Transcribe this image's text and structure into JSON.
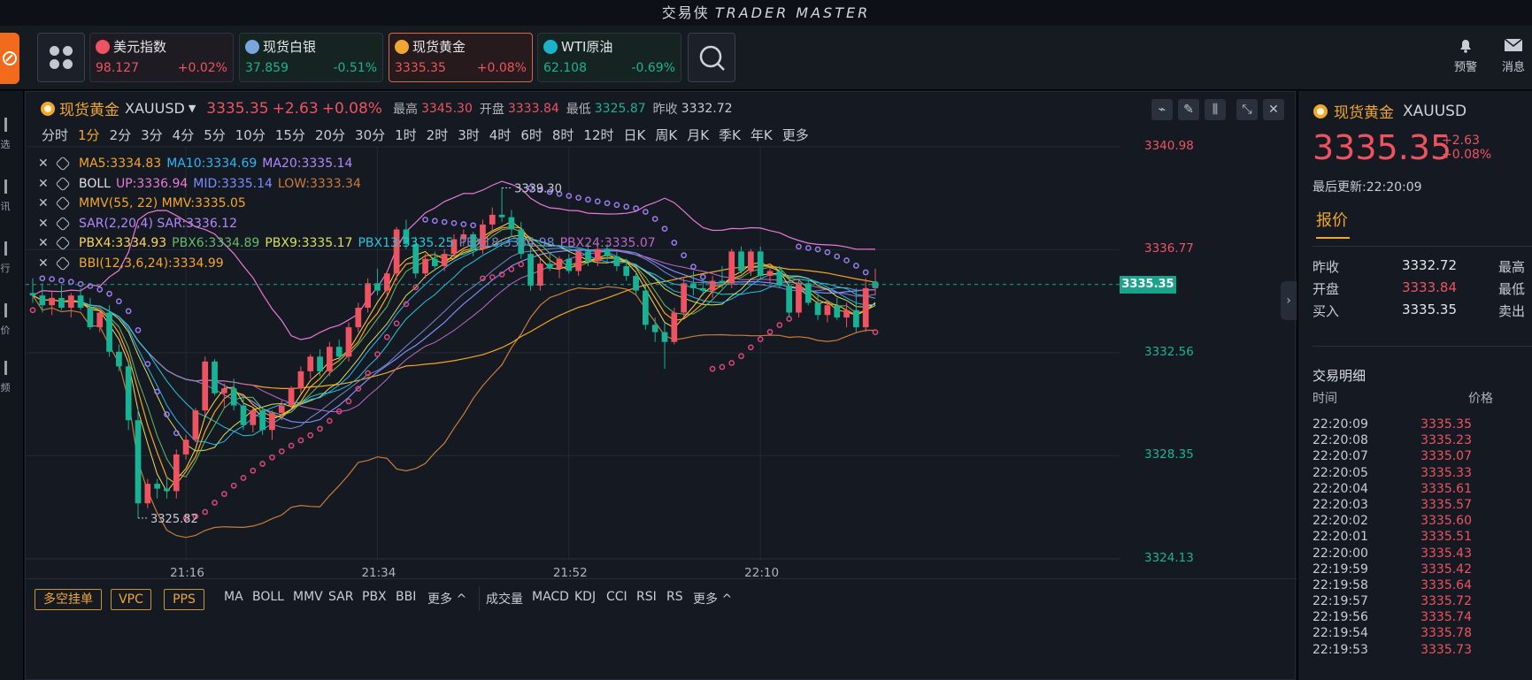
{
  "app": {
    "title_cn": "交易侠",
    "title_en": "TRADER MASTER"
  },
  "quotes": [
    {
      "name": "美元指数",
      "price": "98.127",
      "change": "+0.02%",
      "dir": "up",
      "icon": "us-flag-icon",
      "color": "#ef5260"
    },
    {
      "name": "现货白银",
      "price": "37.859",
      "change": "-0.51%",
      "dir": "dn",
      "icon": "silver-icon",
      "color": "#7aa6e0"
    },
    {
      "name": "现货黄金",
      "price": "3335.35",
      "change": "+0.08%",
      "dir": "up",
      "icon": "gold-icon",
      "color": "#f0a732",
      "active": true
    },
    {
      "name": "WTI原油",
      "price": "62.108",
      "change": "-0.69%",
      "dir": "dn",
      "icon": "oil-icon",
      "color": "#1ab3c9"
    }
  ],
  "top_right": {
    "alert_label": "预警",
    "message_label": "消息"
  },
  "left_strip": [
    "选",
    "讯",
    "行",
    "价",
    "频"
  ],
  "chart_header": {
    "name": "现货黄金",
    "code": "XAUUSD",
    "price": "3335.35",
    "change": "+2.63",
    "change_pct": "+0.08%",
    "high_label": "最高",
    "high": "3345.30",
    "open_label": "开盘",
    "open": "3333.84",
    "low_label": "最低",
    "low": "3325.87",
    "prev_label": "昨收",
    "prev": "3332.72"
  },
  "periods": [
    "分时",
    "1分",
    "2分",
    "3分",
    "4分",
    "5分",
    "10分",
    "15分",
    "20分",
    "30分",
    "1时",
    "2时",
    "3时",
    "4时",
    "6时",
    "8时",
    "12时",
    "日K",
    "周K",
    "月K",
    "季K",
    "年K",
    "更多"
  ],
  "active_period": "1分",
  "indicators": [
    [
      {
        "t": "MA5:3334.83",
        "c": "#f5a623"
      },
      {
        "t": "MA10:3334.69",
        "c": "#29b6f6"
      },
      {
        "t": "MA20:3335.14",
        "c": "#b388ff"
      }
    ],
    [
      {
        "t": "BOLL",
        "c": "#e0e0e0"
      },
      {
        "t": "UP:3336.94",
        "c": "#e879d8"
      },
      {
        "t": "MID:3335.14",
        "c": "#7b8cff"
      },
      {
        "t": "LOW:3333.34",
        "c": "#c97b3a"
      }
    ],
    [
      {
        "t": "MMV(55, 22) MMV:3335.05",
        "c": "#f5a623"
      }
    ],
    [
      {
        "t": "SAR(2,20,4) SAR:3336.12",
        "c": "#b388ff"
      }
    ],
    [
      {
        "t": "PBX4:3334.93",
        "c": "#ffd54f"
      },
      {
        "t": "PBX6:3334.89",
        "c": "#66bb6a"
      },
      {
        "t": "PBX9:3335.17",
        "c": "#d4e157"
      },
      {
        "t": "PBX13:3335.25",
        "c": "#26c6da"
      },
      {
        "t": "PBX18:3334.98",
        "c": "#7986cb"
      },
      {
        "t": "PBX24:3335.07",
        "c": "#ba68c8"
      }
    ],
    [
      {
        "t": "BBI(12,3,6,24):3334.99",
        "c": "#f5a623"
      }
    ]
  ],
  "chart_data": {
    "type": "candlestick",
    "symbol": "XAUUSD",
    "y_ticks": [
      "3340.98",
      "3336.77",
      "3332.56",
      "3328.35",
      "3324.13"
    ],
    "x_ticks": [
      "21:16",
      "21:34",
      "21:52",
      "22:10"
    ],
    "ylim": [
      3324.13,
      3340.98
    ],
    "current": "3335.35",
    "max_label": "3339.30",
    "min_label": "3325.82",
    "candles": [
      [
        3335.0,
        3335.6,
        3334.6,
        3334.9
      ],
      [
        3334.9,
        3335.4,
        3334.2,
        3334.5
      ],
      [
        3334.5,
        3335.1,
        3334.1,
        3334.8
      ],
      [
        3334.8,
        3335.3,
        3334.3,
        3334.4
      ],
      [
        3334.4,
        3335.0,
        3334.0,
        3334.9
      ],
      [
        3334.9,
        3335.2,
        3334.3,
        3334.4
      ],
      [
        3334.4,
        3334.8,
        3333.5,
        3333.6
      ],
      [
        3333.6,
        3334.3,
        3333.4,
        3334.2
      ],
      [
        3334.2,
        3334.5,
        3332.4,
        3332.6
      ],
      [
        3332.6,
        3332.9,
        3331.8,
        3332.0
      ],
      [
        3332.0,
        3332.2,
        3329.4,
        3329.8
      ],
      [
        3329.8,
        3330.3,
        3325.8,
        3326.4
      ],
      [
        3326.4,
        3327.4,
        3326.2,
        3327.2
      ],
      [
        3327.2,
        3327.4,
        3326.6,
        3327.0
      ],
      [
        3327.0,
        3327.5,
        3326.6,
        3326.9
      ],
      [
        3326.9,
        3328.6,
        3326.6,
        3328.4
      ],
      [
        3328.4,
        3329.2,
        3328.2,
        3329.0
      ],
      [
        3329.0,
        3330.3,
        3328.9,
        3330.2
      ],
      [
        3330.2,
        3332.4,
        3330.0,
        3332.2
      ],
      [
        3332.2,
        3332.3,
        3330.8,
        3330.9
      ],
      [
        3330.9,
        3331.3,
        3330.3,
        3331.1
      ],
      [
        3331.1,
        3331.5,
        3330.2,
        3330.4
      ],
      [
        3330.4,
        3330.8,
        3329.4,
        3329.6
      ],
      [
        3329.6,
        3330.3,
        3329.3,
        3330.2
      ],
      [
        3330.2,
        3330.3,
        3329.2,
        3329.4
      ],
      [
        3329.4,
        3330.2,
        3329.0,
        3330.1
      ],
      [
        3330.1,
        3330.6,
        3329.8,
        3330.4
      ],
      [
        3330.4,
        3331.2,
        3330.3,
        3331.1
      ],
      [
        3331.1,
        3332.0,
        3330.9,
        3331.8
      ],
      [
        3331.8,
        3332.5,
        3331.5,
        3332.4
      ],
      [
        3332.4,
        3332.7,
        3331.6,
        3331.8
      ],
      [
        3331.8,
        3333.0,
        3331.6,
        3332.8
      ],
      [
        3332.8,
        3333.1,
        3332.2,
        3332.4
      ],
      [
        3332.4,
        3333.8,
        3332.2,
        3333.6
      ],
      [
        3333.6,
        3334.6,
        3333.4,
        3334.4
      ],
      [
        3334.4,
        3335.6,
        3334.2,
        3335.4
      ],
      [
        3335.4,
        3336.0,
        3334.9,
        3335.1
      ],
      [
        3335.1,
        3335.9,
        3334.9,
        3335.8
      ],
      [
        3335.8,
        3337.7,
        3335.5,
        3337.6
      ],
      [
        3337.6,
        3338.0,
        3336.8,
        3337.0
      ],
      [
        3337.0,
        3337.3,
        3335.6,
        3335.8
      ],
      [
        3335.8,
        3336.6,
        3335.6,
        3336.4
      ],
      [
        3336.4,
        3336.7,
        3336.0,
        3336.1
      ],
      [
        3336.1,
        3336.8,
        3335.9,
        3336.6
      ],
      [
        3336.6,
        3337.4,
        3336.4,
        3337.2
      ],
      [
        3337.2,
        3337.6,
        3336.9,
        3337.4
      ],
      [
        3337.4,
        3337.5,
        3336.5,
        3336.8
      ],
      [
        3336.8,
        3338.0,
        3336.6,
        3337.8
      ],
      [
        3337.8,
        3338.5,
        3337.5,
        3338.2
      ],
      [
        3338.2,
        3339.3,
        3337.9,
        3338.1
      ],
      [
        3338.1,
        3338.4,
        3337.3,
        3337.6
      ],
      [
        3337.6,
        3337.9,
        3336.4,
        3336.6
      ],
      [
        3336.6,
        3336.9,
        3335.1,
        3335.3
      ],
      [
        3335.3,
        3336.4,
        3335.1,
        3336.2
      ],
      [
        3336.2,
        3336.6,
        3335.9,
        3336.0
      ],
      [
        3336.0,
        3336.5,
        3335.6,
        3336.4
      ],
      [
        3336.4,
        3336.6,
        3335.8,
        3335.9
      ],
      [
        3335.9,
        3336.8,
        3335.7,
        3336.7
      ],
      [
        3336.7,
        3337.0,
        3336.1,
        3336.3
      ],
      [
        3336.3,
        3336.9,
        3336.1,
        3336.8
      ],
      [
        3336.8,
        3337.0,
        3336.3,
        3336.5
      ],
      [
        3336.5,
        3336.7,
        3335.9,
        3336.1
      ],
      [
        3336.1,
        3336.4,
        3335.5,
        3335.7
      ],
      [
        3335.7,
        3335.9,
        3334.9,
        3335.1
      ],
      [
        3335.1,
        3335.3,
        3333.5,
        3333.7
      ],
      [
        3333.7,
        3334.0,
        3333.0,
        3333.4
      ],
      [
        3333.4,
        3333.8,
        3331.9,
        3333.0
      ],
      [
        3333.0,
        3334.4,
        3332.9,
        3334.2
      ],
      [
        3334.2,
        3335.6,
        3334.0,
        3335.4
      ],
      [
        3335.4,
        3335.9,
        3334.9,
        3335.2
      ],
      [
        3335.2,
        3335.6,
        3334.9,
        3335.1
      ],
      [
        3335.1,
        3335.7,
        3334.8,
        3335.5
      ],
      [
        3335.5,
        3336.1,
        3335.2,
        3335.4
      ],
      [
        3335.4,
        3336.8,
        3335.2,
        3336.7
      ],
      [
        3336.7,
        3336.9,
        3335.8,
        3335.9
      ],
      [
        3335.9,
        3336.8,
        3335.7,
        3336.7
      ],
      [
        3336.7,
        3336.9,
        3335.6,
        3335.7
      ],
      [
        3335.7,
        3336.1,
        3335.4,
        3335.9
      ],
      [
        3335.9,
        3336.1,
        3335.2,
        3335.3
      ],
      [
        3335.3,
        3335.6,
        3334.0,
        3334.2
      ],
      [
        3334.2,
        3335.6,
        3334.0,
        3335.4
      ],
      [
        3335.4,
        3335.6,
        3334.5,
        3334.6
      ],
      [
        3334.6,
        3335.0,
        3333.9,
        3334.1
      ],
      [
        3334.1,
        3334.7,
        3333.8,
        3334.5
      ],
      [
        3334.5,
        3334.8,
        3333.9,
        3334.0
      ],
      [
        3334.0,
        3334.6,
        3333.6,
        3334.3
      ],
      [
        3334.3,
        3335.2,
        3333.4,
        3333.6
      ],
      [
        3333.6,
        3335.6,
        3333.4,
        3335.2
      ],
      [
        3335.2,
        3336.0,
        3334.9,
        3335.35
      ]
    ]
  },
  "bottom": {
    "boxes": [
      "多空挂单",
      "VPC",
      "PPS"
    ],
    "main_ind": [
      "MA",
      "BOLL",
      "MMV",
      "SAR",
      "PBX",
      "BBI",
      "更多 ^"
    ],
    "sub_ind": [
      "成交量",
      "MACD",
      "KDJ",
      "CCI",
      "RSI",
      "RS",
      "更多 ^"
    ]
  },
  "right": {
    "name": "现货黄金",
    "code": "XAUUSD",
    "price": "3335.35",
    "change": "+2.63",
    "change_pct": "+0.08%",
    "updated": "最后更新:22:20:09",
    "tab": "报价",
    "rows": [
      {
        "k": "昨收",
        "v": "3332.72",
        "c": "#e3e6ea",
        "k2": "最高"
      },
      {
        "k": "开盘",
        "v": "3333.84",
        "c": "#ef5260",
        "k2": "最低"
      },
      {
        "k": "买入",
        "v": "3335.35",
        "c": "#e3e6ea",
        "k2": "卖出"
      }
    ],
    "trades_title": "交易明细",
    "th_time": "时间",
    "th_price": "价格",
    "trades": [
      [
        "22:20:09",
        "3335.35"
      ],
      [
        "22:20:08",
        "3335.23"
      ],
      [
        "22:20:07",
        "3335.07"
      ],
      [
        "22:20:05",
        "3335.33"
      ],
      [
        "22:20:04",
        "3335.61"
      ],
      [
        "22:20:03",
        "3335.57"
      ],
      [
        "22:20:02",
        "3335.60"
      ],
      [
        "22:20:01",
        "3335.51"
      ],
      [
        "22:20:00",
        "3335.43"
      ],
      [
        "22:19:59",
        "3335.42"
      ],
      [
        "22:19:58",
        "3335.64"
      ],
      [
        "22:19:57",
        "3335.72"
      ],
      [
        "22:19:56",
        "3335.74"
      ],
      [
        "22:19:54",
        "3335.78"
      ],
      [
        "22:19:53",
        "3335.73"
      ]
    ]
  }
}
